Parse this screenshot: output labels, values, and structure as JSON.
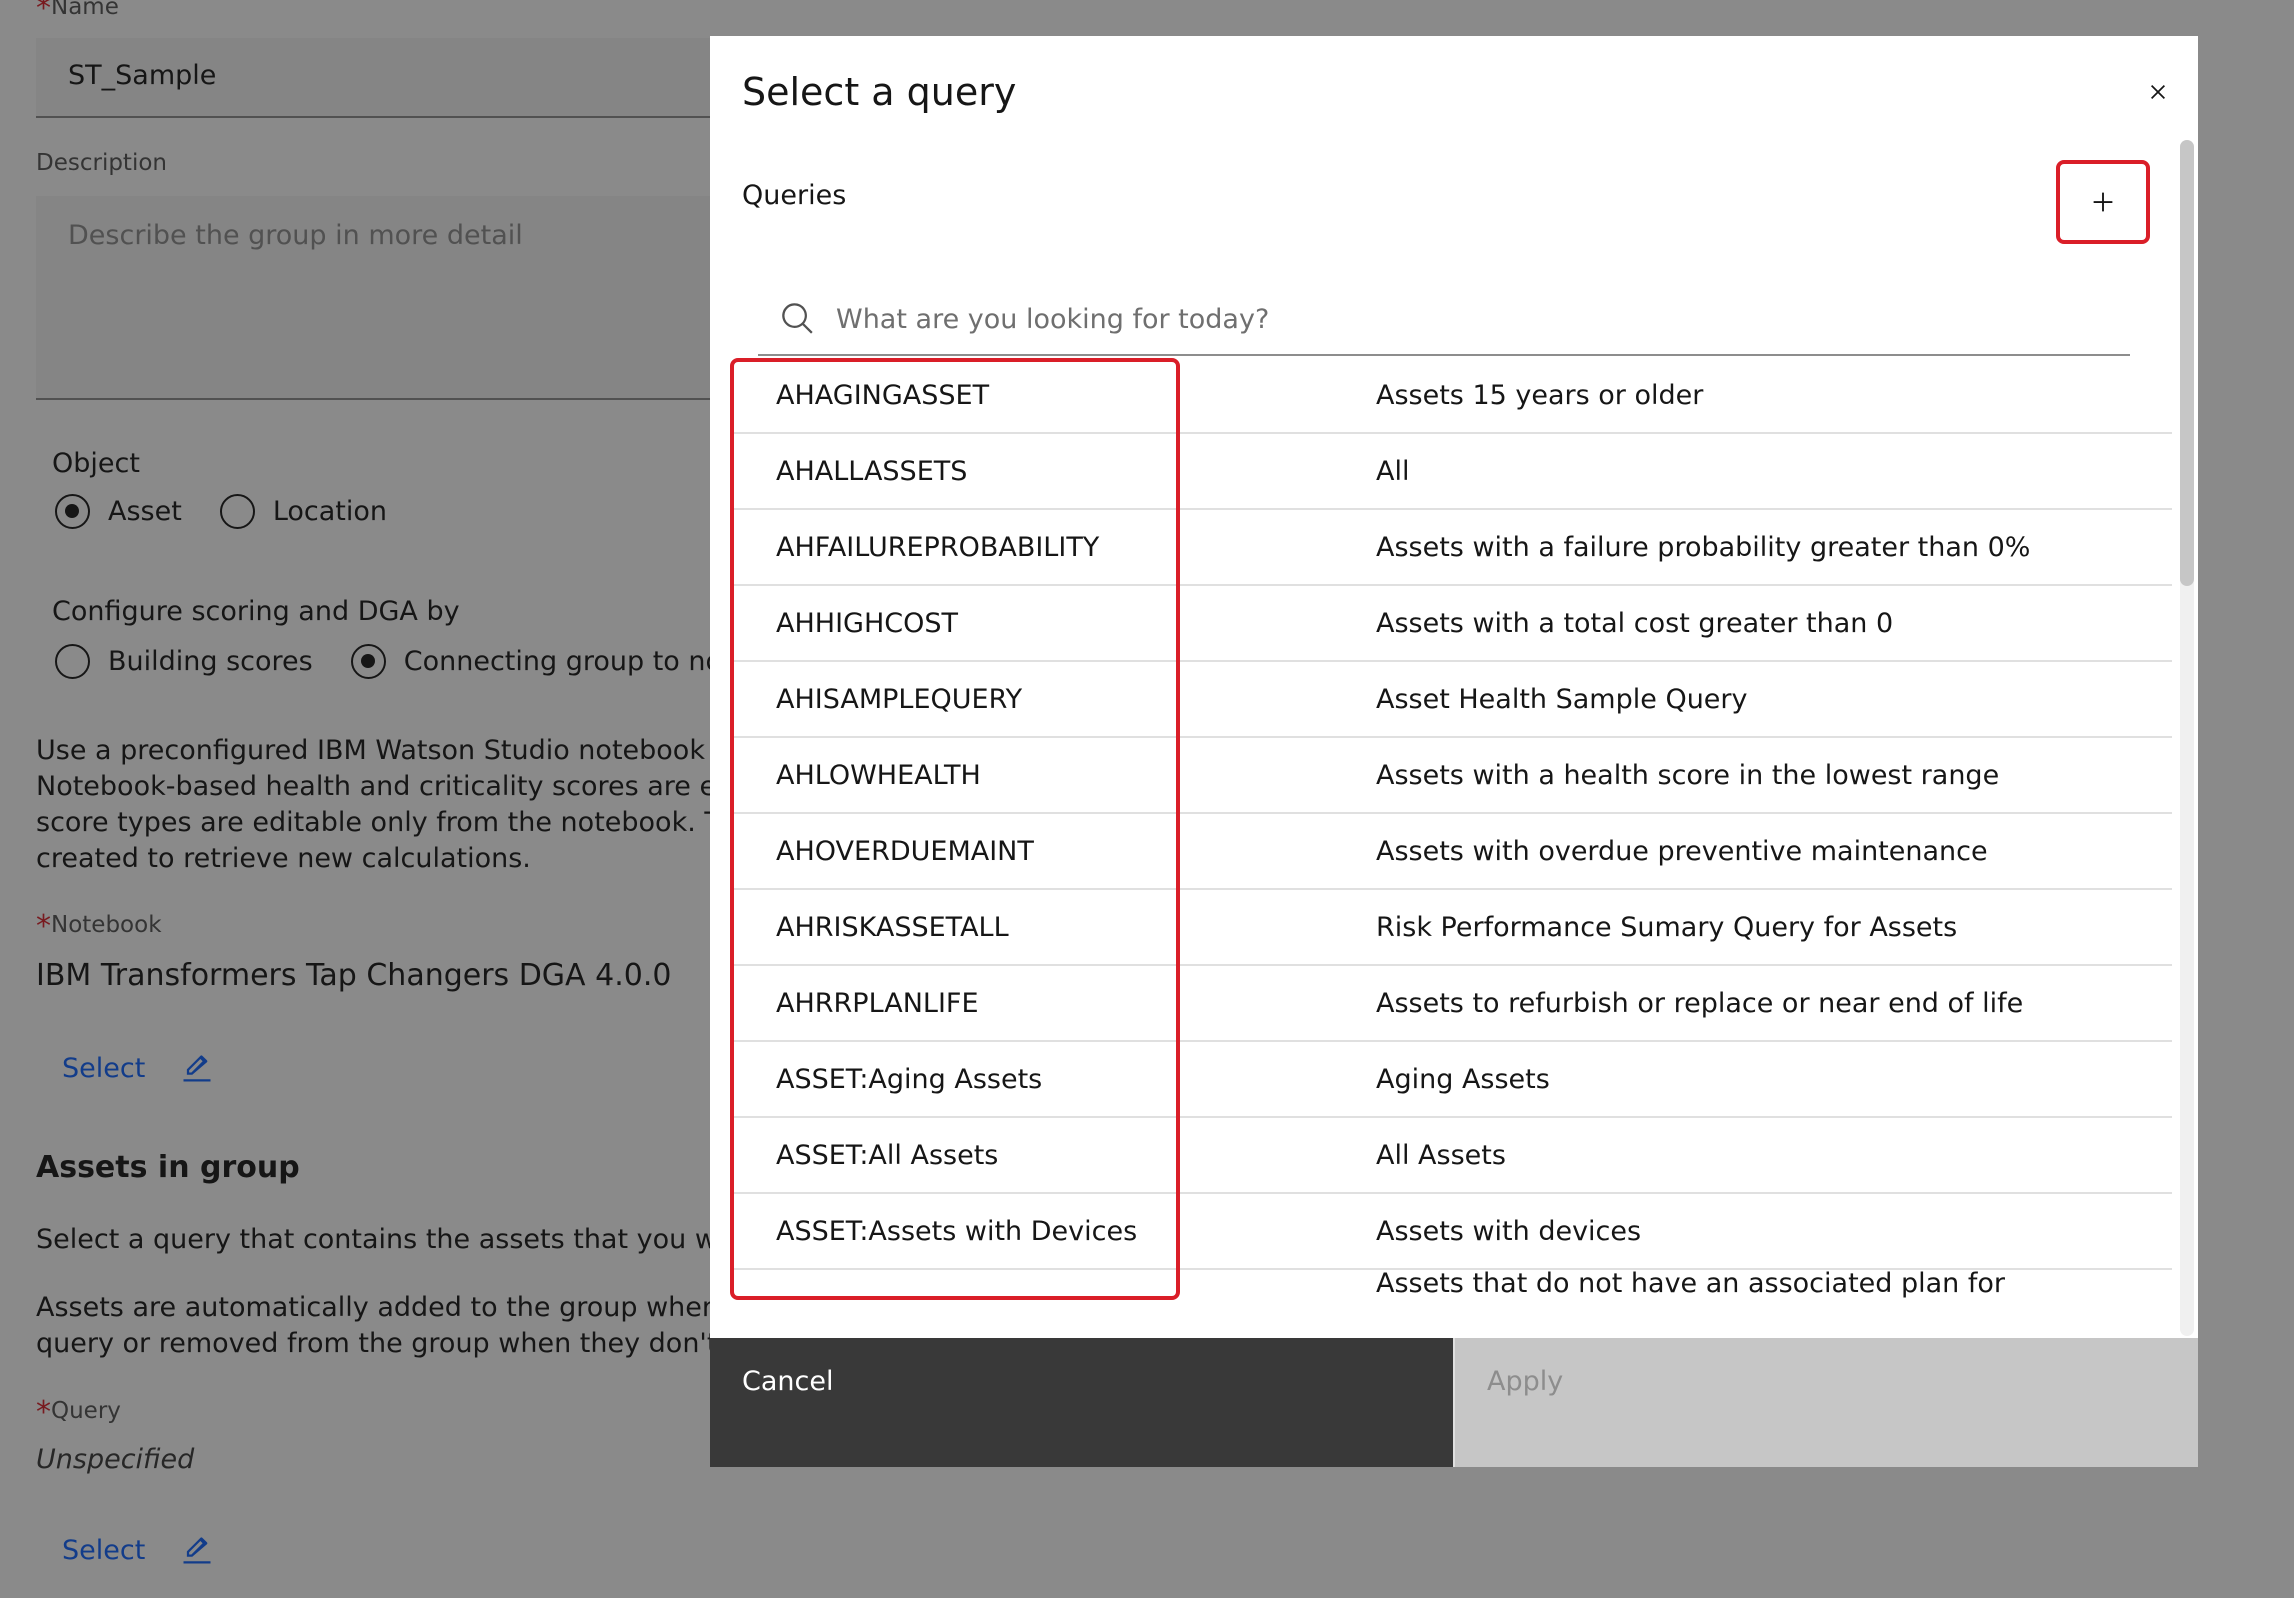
{
  "form": {
    "name_label": "Name",
    "name_value": "ST_Sample",
    "description_label": "Description",
    "description_placeholder": "Describe the group in more detail",
    "object_label": "Object",
    "object_options": [
      "Asset",
      "Location"
    ],
    "object_selected": "Asset",
    "scoring_label": "Configure scoring and DGA by",
    "scoring_options": [
      "Building scores",
      "Connecting group to note"
    ],
    "scoring_selected": "Connecting group to note",
    "notebook_paragraph": [
      "Use a preconfigured IBM Watson Studio notebook to",
      "Notebook-based health and criticality scores are edit",
      "score types are editable only from the notebook. The",
      "created to retrieve new calculations."
    ],
    "notebook_label": "Notebook",
    "notebook_value": "IBM Transformers Tap Changers DGA 4.0.0",
    "select_label": "Select",
    "assets_heading": "Assets in group",
    "assets_text_1": "Select a query that contains the assets that you want",
    "assets_text_2": [
      "Assets are automatically added to the group when th",
      "query or removed from the group when they don't."
    ],
    "query_label": "Query",
    "query_value": "Unspecified"
  },
  "modal": {
    "title": "Select a query",
    "queries_label": "Queries",
    "search_placeholder": "What are you looking for today?",
    "rows": [
      {
        "name": "AHAGINGASSET",
        "description": "Assets 15 years or older"
      },
      {
        "name": "AHALLASSETS",
        "description": "All"
      },
      {
        "name": "AHFAILUREPROBABILITY",
        "description": "Assets with a failure probability greater than 0%"
      },
      {
        "name": "AHHIGHCOST",
        "description": "Assets with a total cost greater than 0"
      },
      {
        "name": "AHISAMPLEQUERY",
        "description": "Asset Health Sample Query"
      },
      {
        "name": "AHLOWHEALTH",
        "description": "Assets with a health score in the lowest range"
      },
      {
        "name": "AHOVERDUEMAINT",
        "description": "Assets with overdue preventive maintenance"
      },
      {
        "name": "AHRISKASSETALL",
        "description": "Risk Performance Sumary Query for Assets"
      },
      {
        "name": "AHRRPLANLIFE",
        "description": "Assets to refurbish or replace or near end of life"
      },
      {
        "name": "ASSET:Aging Assets",
        "description": "Aging Assets"
      },
      {
        "name": "ASSET:All Assets",
        "description": "All Assets"
      },
      {
        "name": "ASSET:Assets with Devices",
        "description": "Assets with devices"
      },
      {
        "name": "",
        "description": "Assets that do not have an associated plan for"
      }
    ],
    "cancel_label": "Cancel",
    "apply_label": "Apply"
  },
  "colors": {
    "highlight": "#da1e28",
    "link": "#0f62fe",
    "cancel_bg": "#393939",
    "apply_bg": "#c6c6c6"
  }
}
